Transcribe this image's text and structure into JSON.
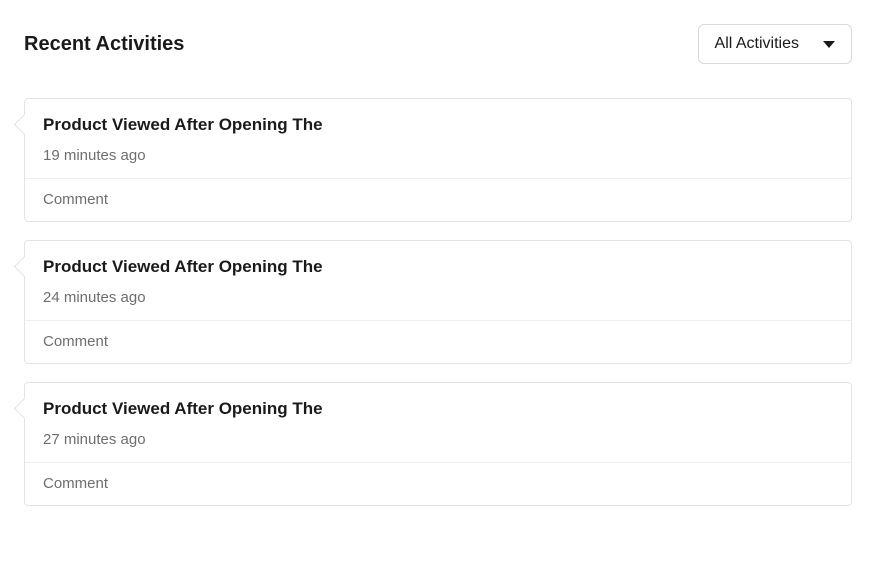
{
  "header": {
    "title": "Recent Activities",
    "filter_label": "All Activities"
  },
  "activities": [
    {
      "title": "Product Viewed After Opening The",
      "time": "19 minutes ago",
      "comment_label": "Comment"
    },
    {
      "title": "Product Viewed After Opening The",
      "time": "24 minutes ago",
      "comment_label": "Comment"
    },
    {
      "title": "Product Viewed After Opening The",
      "time": "27 minutes ago",
      "comment_label": "Comment"
    }
  ]
}
